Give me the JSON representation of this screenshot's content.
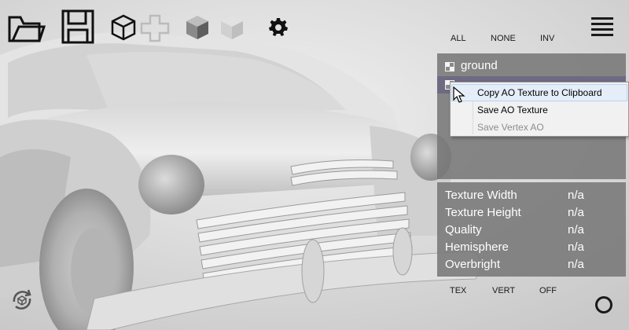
{
  "toolbar": {
    "icons": [
      "open-folder-icon",
      "save-disk-icon",
      "wire-cube-icon",
      "cross-icon",
      "shaded-cube-icon",
      "ghost-cube-icon",
      "gear-icon"
    ]
  },
  "selection": {
    "all": "ALL",
    "none": "NONE",
    "inv": "INV"
  },
  "layers": [
    {
      "label": "ground",
      "checked": true
    },
    {
      "label": "",
      "checked": true,
      "selected": true
    }
  ],
  "context_menu": {
    "items": [
      {
        "label": "Copy AO Texture to Clipboard",
        "enabled": true,
        "highlighted": true
      },
      {
        "label": "Save AO Texture",
        "enabled": true
      },
      {
        "label": "Save Vertex AO",
        "enabled": false
      }
    ]
  },
  "info": [
    {
      "key": "Texture Width",
      "value": "n/a"
    },
    {
      "key": "Texture Height",
      "value": "n/a"
    },
    {
      "key": "Quality",
      "value": "n/a"
    },
    {
      "key": "Hemisphere",
      "value": "n/a"
    },
    {
      "key": "Overbright",
      "value": "n/a"
    }
  ],
  "bottom": {
    "tex": "TEX",
    "vert": "VERT",
    "off": "OFF"
  },
  "colors": {
    "panel": "#787878",
    "selected_row": "#6e6a82",
    "menu_highlight": "#e5eef8"
  }
}
